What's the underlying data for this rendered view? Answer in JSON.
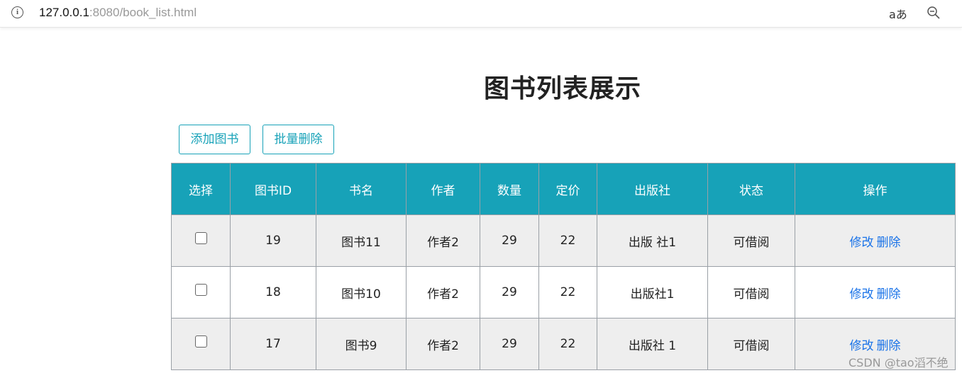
{
  "browser": {
    "url_host": "127.0.0.1",
    "url_rest": ":8080/book_list.html",
    "read_aloud_label": "aあ"
  },
  "page": {
    "title": "图书列表展示",
    "add_button": "添加图书",
    "batch_delete_button": "批量删除"
  },
  "table": {
    "headers": [
      "选择",
      "图书ID",
      "书名",
      "作者",
      "数量",
      "定价",
      "出版社",
      "状态",
      "操作"
    ],
    "rows": [
      {
        "id": "19",
        "name": "图书11",
        "author": "作者2",
        "count": "29",
        "price": "22",
        "publisher": "出版 社1",
        "status": "可借阅",
        "edit": "修改",
        "delete": "删除"
      },
      {
        "id": "18",
        "name": "图书10",
        "author": "作者2",
        "count": "29",
        "price": "22",
        "publisher": "出版社1",
        "status": "可借阅",
        "edit": "修改",
        "delete": "删除"
      },
      {
        "id": "17",
        "name": "图书9",
        "author": "作者2",
        "count": "29",
        "price": "22",
        "publisher": "出版社 1",
        "status": "可借阅",
        "edit": "修改",
        "delete": "删除"
      }
    ]
  },
  "watermark": "CSDN @tao滔不绝",
  "colors": {
    "accent": "#17a2b8",
    "link": "#1a73e8",
    "stripe": "#eeeeee"
  }
}
